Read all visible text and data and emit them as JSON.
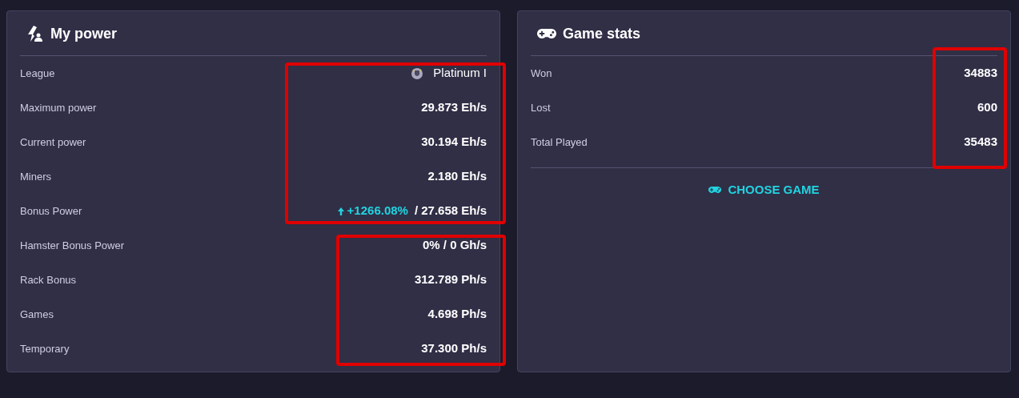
{
  "power": {
    "title": "My power",
    "groups": [
      {
        "highlighted": true,
        "rows": [
          {
            "kind": "league",
            "label": "League",
            "value": "Platinum I"
          },
          {
            "kind": "plain",
            "label": "Maximum power",
            "value": "29.873 Eh/s"
          },
          {
            "kind": "plain",
            "label": "Current power",
            "value": "30.194 Eh/s"
          },
          {
            "kind": "plain",
            "label": "Miners",
            "value": "2.180 Eh/s"
          },
          {
            "kind": "bonus",
            "label": "Bonus Power",
            "percent": "+1266.08%",
            "value": "/ 27.658 Eh/s"
          }
        ]
      },
      {
        "highlighted": true,
        "rows": [
          {
            "kind": "plain",
            "label": "Hamster Bonus Power",
            "value": "0% / 0 Gh/s"
          },
          {
            "kind": "plain",
            "label": "Rack Bonus",
            "value": "312.789 Ph/s"
          },
          {
            "kind": "plain",
            "label": "Games",
            "value": "4.698 Ph/s"
          },
          {
            "kind": "plain",
            "label": "Temporary",
            "value": "37.300 Ph/s"
          }
        ]
      }
    ]
  },
  "game_stats": {
    "title": "Game stats",
    "groups": [
      {
        "highlighted": true,
        "rows": [
          {
            "kind": "plain",
            "label": "Won",
            "value": "34883"
          },
          {
            "kind": "plain",
            "label": "Lost",
            "value": "600"
          },
          {
            "kind": "plain",
            "label": "Total Played",
            "value": "35483"
          }
        ]
      }
    ],
    "action": "CHOOSE GAME"
  }
}
